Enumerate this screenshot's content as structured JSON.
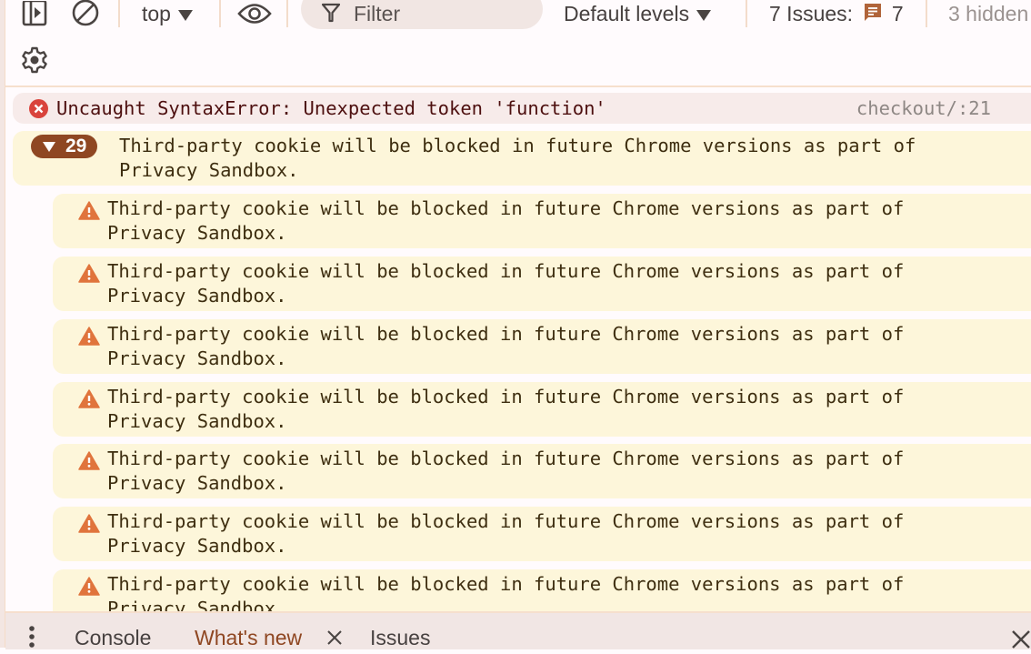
{
  "toolbar": {
    "context_label": "top",
    "filter_placeholder": "Filter",
    "levels_label": "Default levels",
    "issues_label": "7 Issues:",
    "issues_count": "7",
    "hidden_label": "3 hidden"
  },
  "console": {
    "error": {
      "message": "Uncaught SyntaxError: Unexpected token 'function'",
      "source": "checkout/:21"
    },
    "group": {
      "count": "29",
      "message": "Third-party cookie will be blocked in future Chrome versions as part of\nPrivacy Sandbox."
    },
    "warnings": [
      {
        "message": "Third-party cookie will be blocked in future Chrome versions as part of\nPrivacy Sandbox."
      },
      {
        "message": "Third-party cookie will be blocked in future Chrome versions as part of\nPrivacy Sandbox."
      },
      {
        "message": "Third-party cookie will be blocked in future Chrome versions as part of\nPrivacy Sandbox."
      },
      {
        "message": "Third-party cookie will be blocked in future Chrome versions as part of\nPrivacy Sandbox."
      },
      {
        "message": "Third-party cookie will be blocked in future Chrome versions as part of\nPrivacy Sandbox."
      },
      {
        "message": "Third-party cookie will be blocked in future Chrome versions as part of\nPrivacy Sandbox."
      },
      {
        "message": "Third-party cookie will be blocked in future Chrome versions as part of\nPrivacy Sandbox."
      }
    ]
  },
  "drawer": {
    "tabs": [
      {
        "label": "Console"
      },
      {
        "label": "What's new"
      },
      {
        "label": "Issues"
      }
    ]
  },
  "colors": {
    "accent": "#8f4722",
    "error": "#d9433c",
    "warning_icon": "#e0743c",
    "warning_bg": "#fdf6da",
    "error_bg": "#f7ebea"
  }
}
